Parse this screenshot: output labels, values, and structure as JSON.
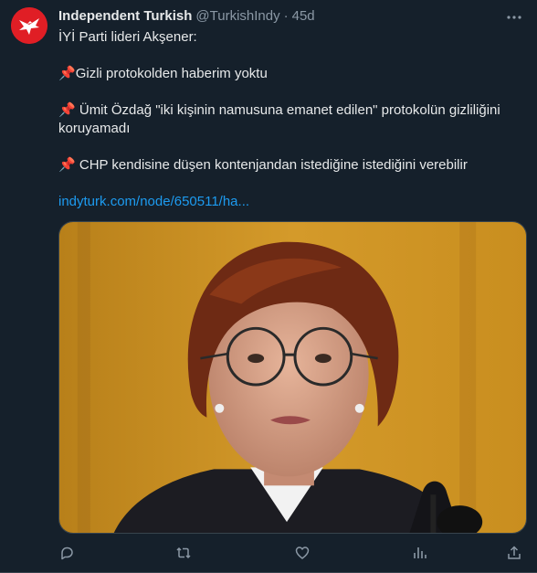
{
  "tweet": {
    "author": {
      "display_name": "Independent Turkish",
      "handle": "@TurkishIndy",
      "separator": "·",
      "time": "45d",
      "avatar_icon": "independent-eagle-logo"
    },
    "lines": {
      "line1": "İYİ Parti lideri Akşener:",
      "line2_pin": "📌",
      "line2": "Gizli protokolden haberim yoktu",
      "line3_pin": " 📌",
      "line3": " Ümit Özdağ \"iki kişinin namusuna emanet edilen\" protokolün gizliliğini koruyamadı",
      "line4_pin": "📌",
      "line4": " CHP kendisine düşen kontenjandan istediğine istediğini verebilir"
    },
    "link_text": "indyturk.com/node/650511/ha...",
    "media_alt": "photo",
    "actions": [
      {
        "name": "reply-icon"
      },
      {
        "name": "retweet-icon"
      },
      {
        "name": "like-icon"
      },
      {
        "name": "views-icon"
      },
      {
        "name": "share-icon"
      }
    ]
  },
  "colors": {
    "background": "#15202b",
    "text": "#e7e9ea",
    "secondary": "#8b98a5",
    "link": "#1d9bf0",
    "avatar": "#e01e25"
  }
}
